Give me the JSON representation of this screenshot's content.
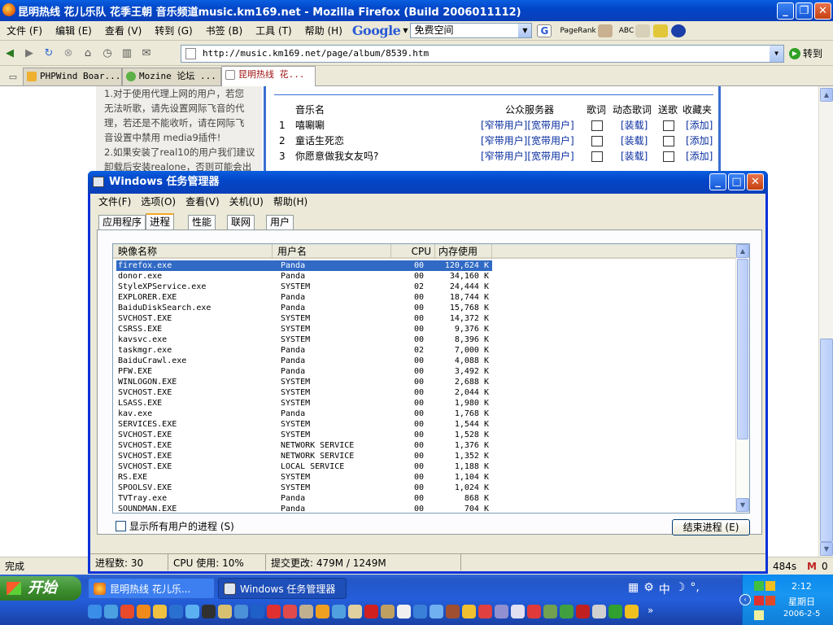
{
  "firefox": {
    "title": "昆明热线 花儿乐队 花季王朝 音乐频道music.km169.net - Mozilla Firefox (Build 2006011112)",
    "menu": [
      "文件 (F)",
      "编辑 (E)",
      "查看 (V)",
      "转到 (G)",
      "书签 (B)",
      "工具 (T)",
      "帮助 (H)"
    ],
    "google_logo": "Google",
    "google_search_value": "免费空间",
    "pagerank_label": "PageRank",
    "abc_label": "ABC",
    "url": "http://music.km169.net/page/album/8539.htm",
    "go_label": "转到",
    "tabs": [
      {
        "label": "PHPWind Boar..."
      },
      {
        "label": "Mozine 论坛 ..."
      },
      {
        "label": "昆明热线 花..."
      }
    ],
    "status": "完成",
    "status_right": "484s",
    "mail_count": "0"
  },
  "page": {
    "left_text": [
      "1.对于使用代理上网的用户，若您",
      "无法听歌，请先设置网际飞音的代",
      "理，若还是不能收听，请在网际飞",
      "音设置中禁用 media9插件!",
      "2.如果安装了real10的用户我们建议",
      "卸载后安装realone，否则可能会出"
    ],
    "headers": [
      "音乐名",
      "公众服务器",
      "歌词",
      "动态歌词",
      "送歌",
      "收藏夹"
    ],
    "songs": [
      {
        "n": "1",
        "name": "嘻唰唰",
        "servers": "[窄带用户][宽带用户]",
        "dyn": "[装载]",
        "fav": "[添加]"
      },
      {
        "n": "2",
        "name": "童话生死恋",
        "servers": "[窄带用户][宽带用户]",
        "dyn": "[装载]",
        "fav": "[添加]"
      },
      {
        "n": "3",
        "name": "你愿意做我女友吗?",
        "servers": "[窄带用户][宽带用户]",
        "dyn": "[装载]",
        "fav": "[添加]"
      }
    ]
  },
  "taskmgr": {
    "title": "Windows 任务管理器",
    "menu": [
      "文件(F)",
      "选项(O)",
      "查看(V)",
      "关机(U)",
      "帮助(H)"
    ],
    "tabs": [
      "应用程序",
      "进程",
      "性能",
      "联网",
      "用户"
    ],
    "active_tab": "进程",
    "columns": [
      "映像名称",
      "用户名",
      "CPU",
      "内存使用"
    ],
    "processes": [
      {
        "name": "firefox.exe",
        "user": "Panda",
        "cpu": "00",
        "mem": "120,624 K"
      },
      {
        "name": "donor.exe",
        "user": "Panda",
        "cpu": "00",
        "mem": "34,160 K"
      },
      {
        "name": "StyleXPService.exe",
        "user": "SYSTEM",
        "cpu": "02",
        "mem": "24,444 K"
      },
      {
        "name": "EXPLORER.EXE",
        "user": "Panda",
        "cpu": "00",
        "mem": "18,744 K"
      },
      {
        "name": "BaiduDiskSearch.exe",
        "user": "Panda",
        "cpu": "00",
        "mem": "15,768 K"
      },
      {
        "name": "SVCHOST.EXE",
        "user": "SYSTEM",
        "cpu": "00",
        "mem": "14,372 K"
      },
      {
        "name": "CSRSS.EXE",
        "user": "SYSTEM",
        "cpu": "00",
        "mem": "9,376 K"
      },
      {
        "name": "kavsvc.exe",
        "user": "SYSTEM",
        "cpu": "00",
        "mem": "8,396 K"
      },
      {
        "name": "taskmgr.exe",
        "user": "Panda",
        "cpu": "02",
        "mem": "7,000 K"
      },
      {
        "name": "BaiduCrawl.exe",
        "user": "Panda",
        "cpu": "00",
        "mem": "4,088 K"
      },
      {
        "name": "PFW.EXE",
        "user": "Panda",
        "cpu": "00",
        "mem": "3,492 K"
      },
      {
        "name": "WINLOGON.EXE",
        "user": "SYSTEM",
        "cpu": "00",
        "mem": "2,688 K"
      },
      {
        "name": "SVCHOST.EXE",
        "user": "SYSTEM",
        "cpu": "00",
        "mem": "2,044 K"
      },
      {
        "name": "LSASS.EXE",
        "user": "SYSTEM",
        "cpu": "00",
        "mem": "1,980 K"
      },
      {
        "name": "kav.exe",
        "user": "Panda",
        "cpu": "00",
        "mem": "1,768 K"
      },
      {
        "name": "SERVICES.EXE",
        "user": "SYSTEM",
        "cpu": "00",
        "mem": "1,544 K"
      },
      {
        "name": "SVCHOST.EXE",
        "user": "SYSTEM",
        "cpu": "00",
        "mem": "1,528 K"
      },
      {
        "name": "SVCHOST.EXE",
        "user": "NETWORK SERVICE",
        "cpu": "00",
        "mem": "1,376 K"
      },
      {
        "name": "SVCHOST.EXE",
        "user": "NETWORK SERVICE",
        "cpu": "00",
        "mem": "1,352 K"
      },
      {
        "name": "SVCHOST.EXE",
        "user": "LOCAL SERVICE",
        "cpu": "00",
        "mem": "1,188 K"
      },
      {
        "name": "RS.EXE",
        "user": "SYSTEM",
        "cpu": "00",
        "mem": "1,104 K"
      },
      {
        "name": "SPOOLSV.EXE",
        "user": "SYSTEM",
        "cpu": "00",
        "mem": "1,024 K"
      },
      {
        "name": "TVTray.exe",
        "user": "Panda",
        "cpu": "00",
        "mem": "868 K"
      },
      {
        "name": "SOUNDMAN.EXE",
        "user": "Panda",
        "cpu": "00",
        "mem": "704 K"
      }
    ],
    "show_all_label": "显示所有用户的进程 (S)",
    "end_process_label": "结束进程 (E)",
    "status": {
      "processes": "进程数: 30",
      "cpu": "CPU 使用: 10%",
      "commit": "提交更改: 479M / 1249M"
    }
  },
  "taskbar": {
    "start_label": "开始",
    "tasks": [
      "昆明热线 花儿乐...",
      "Windows 任务管理器"
    ],
    "time": "2:12",
    "weekday": "星期日",
    "date": "2006-2-5",
    "ime": "中"
  },
  "colors": {
    "xp_blue": "#0a5fe0",
    "selection": "#316ac5",
    "link_blue": "#0a2fa0",
    "start_green": "#3c8d2e"
  }
}
